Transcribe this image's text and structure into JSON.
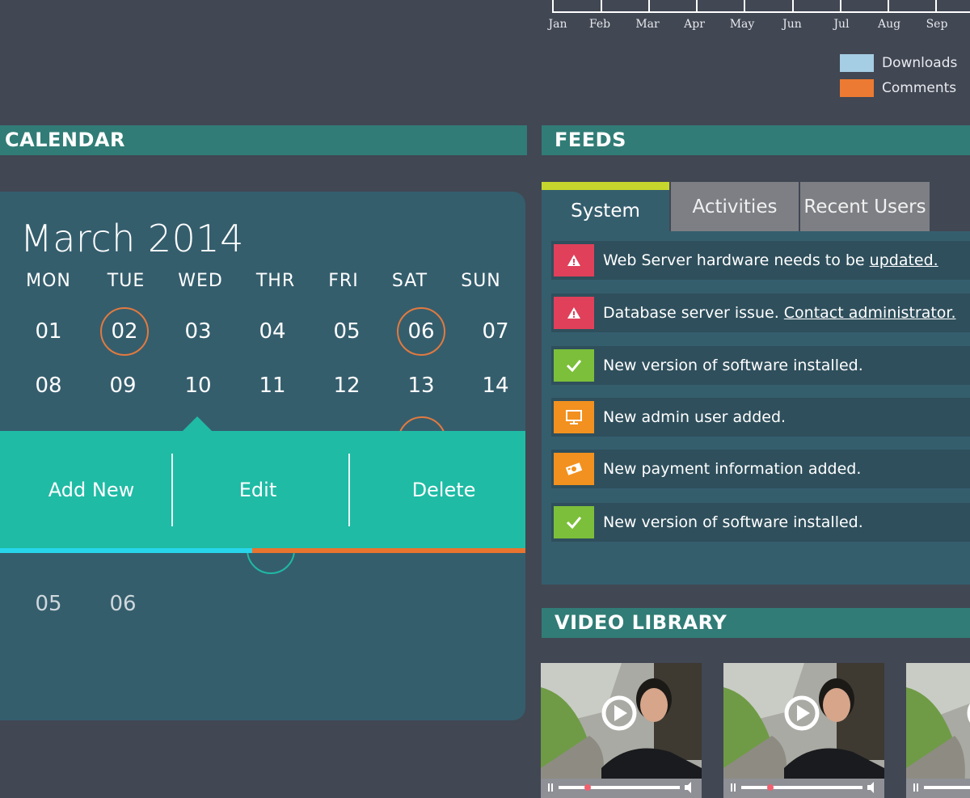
{
  "chart": {
    "months": [
      "Jan",
      "Feb",
      "Mar",
      "Apr",
      "May",
      "Jun",
      "Jul",
      "Aug",
      "Sep"
    ],
    "legend": [
      {
        "label": "Downloads",
        "color": "#a5cde3"
      },
      {
        "label": "Comments",
        "color": "#ec7a32"
      }
    ]
  },
  "calendar": {
    "section_title": "CALENDAR",
    "month_title": "March 2014",
    "weekdays": [
      "MON",
      "TUE",
      "WED",
      "THR",
      "FRI",
      "SAT",
      "SUN"
    ],
    "week1": [
      "01",
      "02",
      "03",
      "04",
      "05",
      "06",
      "07"
    ],
    "week2": [
      "08",
      "09",
      "10",
      "11",
      "12",
      "13",
      "14"
    ],
    "week_last": [
      "05",
      "06"
    ],
    "popup": {
      "add_label": "Add New",
      "edit_label": "Edit",
      "delete_label": "Delete"
    }
  },
  "feeds": {
    "section_title": "FEEDS",
    "tabs": [
      "System",
      "Activities",
      "Recent Users"
    ],
    "items": [
      {
        "icon": "warning-icon",
        "color": "#e0405a",
        "text": "Web Server hardware needs to be ",
        "link": "updated."
      },
      {
        "icon": "warning-icon",
        "color": "#e0405a",
        "text": "Database server issue. ",
        "link": "Contact administrator."
      },
      {
        "icon": "check-icon",
        "color": "#7cbf3a",
        "text": "New version of software installed.",
        "link": ""
      },
      {
        "icon": "monitor-icon",
        "color": "#f2911f",
        "text": "New admin user added.",
        "link": ""
      },
      {
        "icon": "payment-icon",
        "color": "#f2911f",
        "text": "New payment information added.",
        "link": ""
      },
      {
        "icon": "check-icon",
        "color": "#7cbf3a",
        "text": "New version of software installed.",
        "link": ""
      }
    ]
  },
  "video_library": {
    "section_title": "VIDEO LIBRARY"
  }
}
